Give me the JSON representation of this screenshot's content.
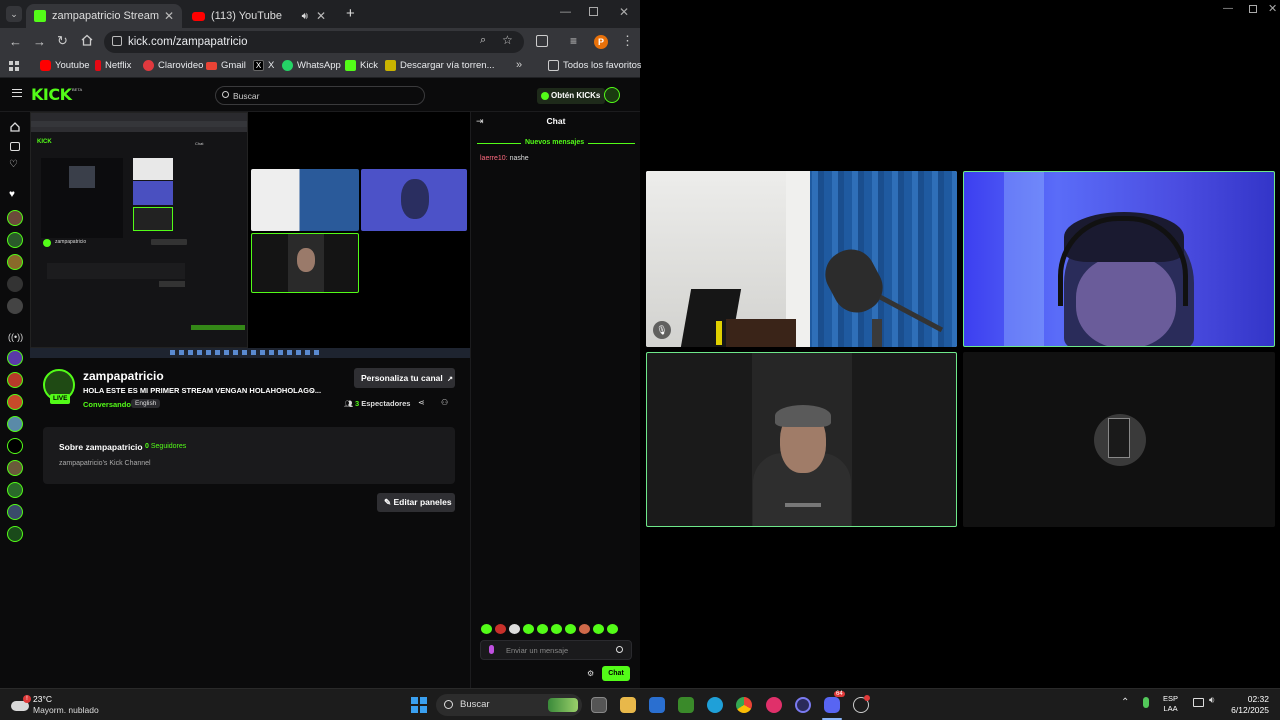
{
  "browser": {
    "tabs": [
      {
        "label": "zampapatricio Stream - Watch L",
        "active": true
      },
      {
        "label": "(113) YouTube",
        "active": false
      }
    ],
    "new_tab_icon": "plus-icon",
    "url": "kick.com/zampapatricio",
    "profile_initial": "P",
    "bookmarks": [
      {
        "label": "Youtube",
        "color": "#ff0000"
      },
      {
        "label": "Netflix",
        "color": "#e50914"
      },
      {
        "label": "Clarovideo",
        "color": "#e0393e"
      },
      {
        "label": "Gmail",
        "color": "#ea4335"
      },
      {
        "label": "X",
        "color": "#ffffff"
      },
      {
        "label": "WhatsApp",
        "color": "#25d366"
      },
      {
        "label": "Kick",
        "color": "#53fc18"
      },
      {
        "label": "Descargar vía torren...",
        "color": "#c9b400"
      }
    ],
    "all_favorites": "Todos los favoritos"
  },
  "kick": {
    "logo": "KICK",
    "logo_badge": "BETA",
    "search_placeholder": "Buscar",
    "get_kicks": "Obtén KICKs",
    "channel": {
      "name": "zampapatricio",
      "live_badge": "LIVE",
      "title": "HOLA ESTE ES MI PRIMER STREAM VENGAN HOLAHOHOLAGO...",
      "category": "Conversando",
      "language": "English",
      "customize_button": "Personaliza tu canal",
      "viewers_count": "3",
      "viewers_label": "Espectadores"
    },
    "about": {
      "title": "Sobre zampapatricio",
      "followers_count": "0",
      "followers_label": "Seguidores",
      "description": "zampapatricio's Kick Channel"
    },
    "edit_panels": "Editar paneles",
    "chat": {
      "title": "Chat",
      "new_messages": "Nuevos mensajes",
      "messages": [
        {
          "user": "laerre10",
          "text": "nashe",
          "color": "#ff6a7f"
        }
      ],
      "input_placeholder": "Enviar un mensaje",
      "send_button": "Chat"
    }
  },
  "taskbar": {
    "weather_temp": "23°C",
    "weather_desc": "Mayorm. nublado",
    "search_placeholder": "Buscar",
    "lang_top": "ESP",
    "lang_bottom": "LAA",
    "time": "02:32",
    "date": "6/12/2025",
    "discord_badge": "64"
  },
  "colors": {
    "kick_green": "#53fc18",
    "chrome_dark": "#202124",
    "chrome_toolbar": "#35363a"
  }
}
